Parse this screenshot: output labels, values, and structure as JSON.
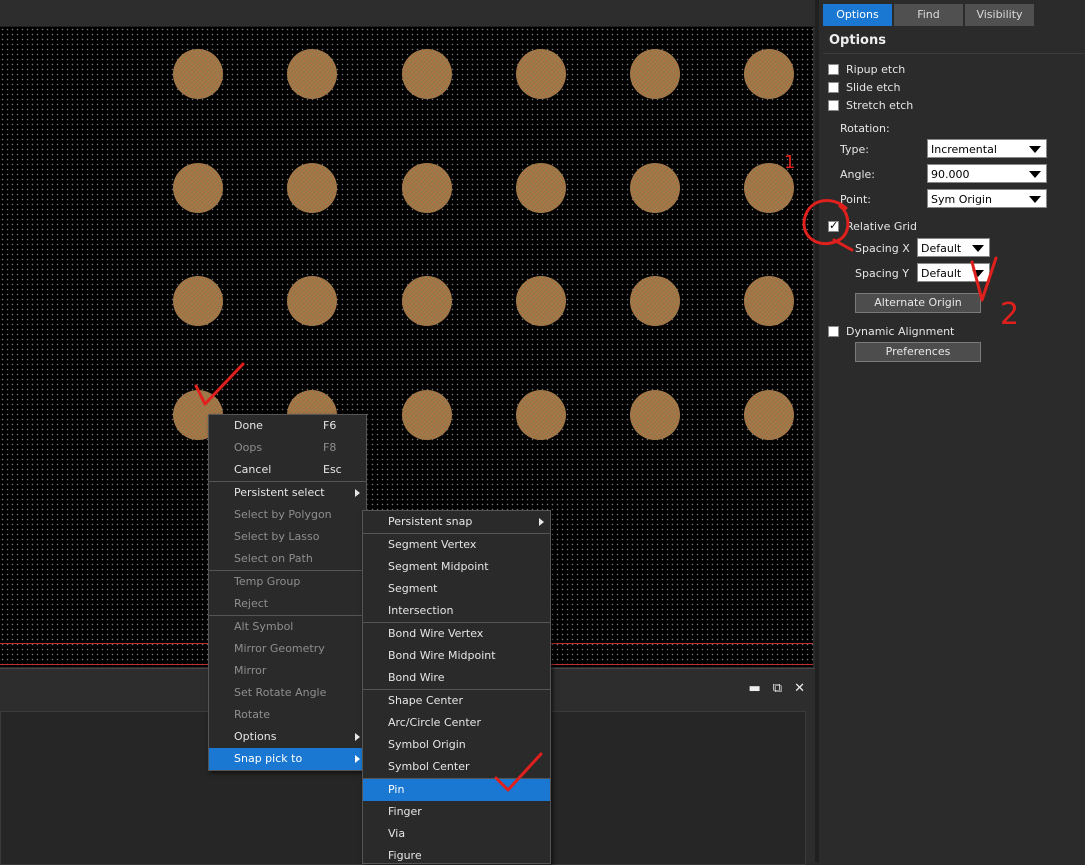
{
  "sidebar": {
    "tabs": [
      {
        "label": "Options",
        "active": true
      },
      {
        "label": "Find",
        "active": false
      },
      {
        "label": "Visibility",
        "active": false
      }
    ],
    "title": "Options",
    "ripup_etch": "Ripup etch",
    "slide_etch": "Slide etch",
    "stretch_etch": "Stretch etch",
    "rotation_label": "Rotation:",
    "type_label": "Type:",
    "type_value": "Incremental",
    "angle_label": "Angle:",
    "angle_value": "90.000",
    "point_label": "Point:",
    "point_value": "Sym Origin",
    "relative_grid": "Relative Grid",
    "spacing_x_label": "Spacing  X",
    "spacing_x_value": "Default",
    "spacing_y_label": "Spacing  Y",
    "spacing_y_value": "Default",
    "alternate_origin": "Alternate Origin",
    "dynamic_alignment": "Dynamic Alignment",
    "preferences": "Preferences"
  },
  "context_menu": {
    "items": [
      {
        "label": "Done",
        "shortcut": "F6",
        "enabled": true
      },
      {
        "label": "Oops",
        "shortcut": "F8",
        "enabled": false
      },
      {
        "label": "Cancel",
        "shortcut": "Esc",
        "enabled": true
      },
      {
        "label": "Persistent select",
        "enabled": true,
        "submenu": true
      },
      {
        "label": "Select by Polygon",
        "enabled": false
      },
      {
        "label": "Select by Lasso",
        "enabled": false
      },
      {
        "label": "Select on Path",
        "enabled": false
      },
      {
        "label": "Temp Group",
        "enabled": false
      },
      {
        "label": "Reject",
        "enabled": false
      },
      {
        "label": "Alt Symbol",
        "enabled": false
      },
      {
        "label": "Mirror Geometry",
        "enabled": false
      },
      {
        "label": "Mirror",
        "enabled": false
      },
      {
        "label": "Set Rotate Angle",
        "enabled": false
      },
      {
        "label": "Rotate",
        "enabled": false
      },
      {
        "label": "Options",
        "enabled": true,
        "submenu": true
      },
      {
        "label": "Snap pick to",
        "enabled": true,
        "submenu": true,
        "highlighted": true
      }
    ]
  },
  "snap_menu": {
    "items": [
      {
        "label": "Persistent snap",
        "submenu": true
      },
      {
        "label": "Segment Vertex"
      },
      {
        "label": "Segment Midpoint"
      },
      {
        "label": "Segment"
      },
      {
        "label": "Intersection"
      },
      {
        "label": "Bond Wire Vertex"
      },
      {
        "label": "Bond Wire Midpoint"
      },
      {
        "label": "Bond Wire"
      },
      {
        "label": "Shape Center"
      },
      {
        "label": "Arc/Circle Center"
      },
      {
        "label": "Symbol Origin"
      },
      {
        "label": "Symbol Center"
      },
      {
        "label": "Pin",
        "highlighted": true
      },
      {
        "label": "Finger"
      },
      {
        "label": "Via"
      },
      {
        "label": "Figure"
      }
    ]
  },
  "pads": [
    [
      "",
      "",
      "",
      "",
      "",
      ""
    ],
    [
      "",
      "",
      "",
      "",
      "",
      ""
    ],
    [
      "",
      "",
      "",
      "",
      "",
      ""
    ],
    [
      "",
      "",
      "",
      "",
      "",
      ""
    ]
  ],
  "annotations": {
    "mark_1": "1",
    "mark_2": "2"
  },
  "colors": {
    "accent": "#1a78d2",
    "canvas": "#000000",
    "pad": "#a37a4e",
    "annotation": "#e0201c"
  }
}
